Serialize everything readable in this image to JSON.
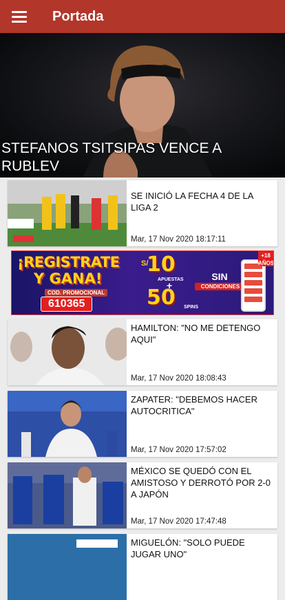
{
  "app": {
    "title": "Portada"
  },
  "hero": {
    "title": "STEFANOS TSITSIPAS VENCE A RUBLEV"
  },
  "ad": {
    "line1": "¡REGISTRATE",
    "line2": "Y GANA!",
    "promo_label": "COD. PROMOCIONAL",
    "promo_code": "610365",
    "currency": "S/",
    "amount_bets": "10",
    "bets_label": "APUESTAS",
    "plus": "+",
    "amount_spins": "50",
    "spins_label": "SPINS",
    "no_label": "SIN",
    "conditions_label": "CONDICIONES",
    "age_badge": "+18 AÑOS"
  },
  "articles": [
    {
      "headline": "SE INICIÓ LA FECHA 4 DE LA LIGA 2",
      "date": "Mar, 17 Nov 2020 18:17:11"
    },
    {
      "headline": "HAMILTON: \"NO ME DETENGO AQUI\"",
      "date": "Mar, 17 Nov 2020 18:08:43"
    },
    {
      "headline": "ZAPATER: \"DEBEMOS HACER AUTOCRITICA\"",
      "date": "Mar, 17 Nov 2020 17:57:02"
    },
    {
      "headline": "MÉXICO SE QUEDÓ CON EL AMISTOSO Y DERROTÓ POR 2-0 A JAPÓN",
      "date": "Mar, 17 Nov 2020 17:47:48"
    },
    {
      "headline": "MIGUELÓN: \"SOLO PUEDE JUGAR UNO\"",
      "date": ""
    }
  ],
  "colors": {
    "appbar": "#b3362a"
  },
  "icons": {
    "menu": "hamburger-menu-icon"
  }
}
